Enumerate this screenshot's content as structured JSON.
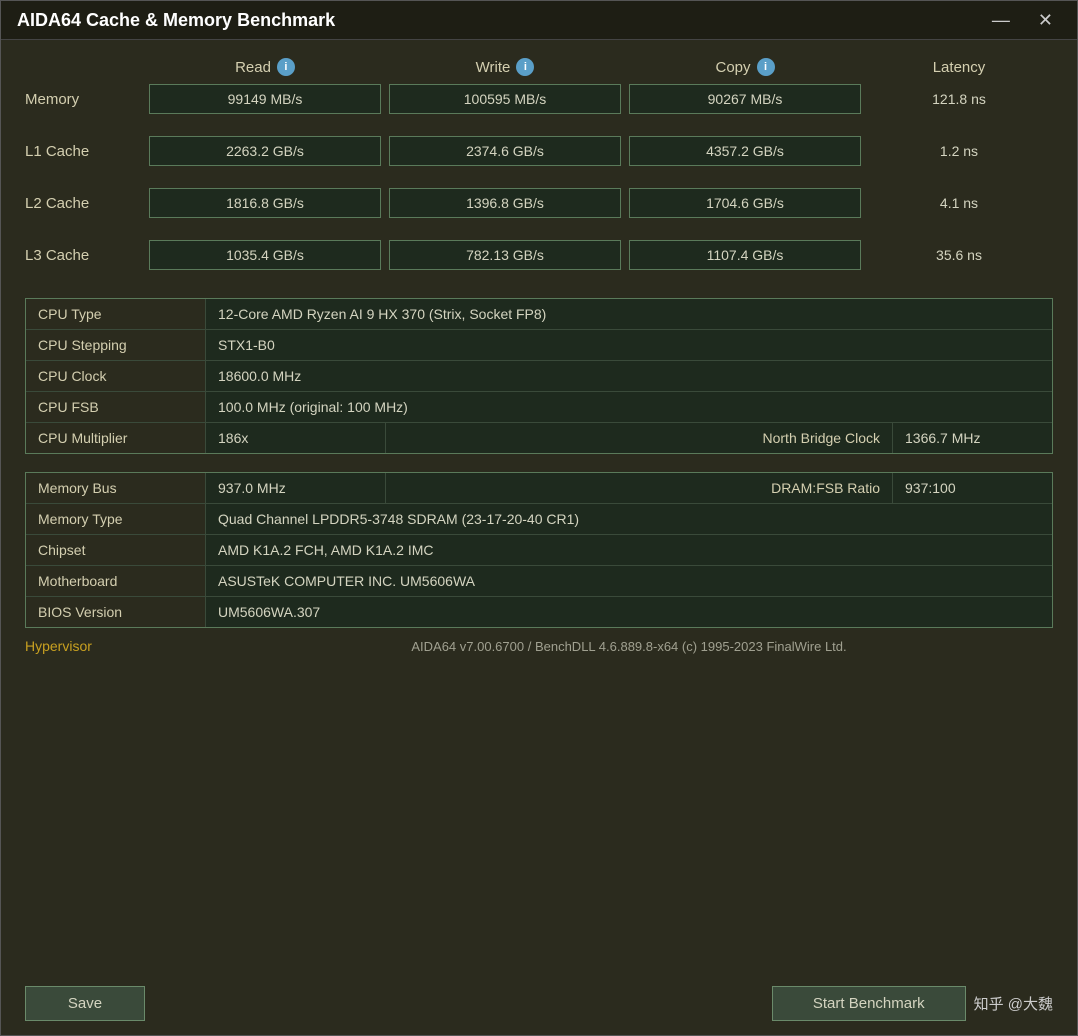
{
  "window": {
    "title": "AIDA64 Cache & Memory Benchmark",
    "minimize_label": "—",
    "close_label": "✕"
  },
  "headers": {
    "read": "Read",
    "write": "Write",
    "copy": "Copy",
    "latency": "Latency"
  },
  "rows": [
    {
      "label": "Memory",
      "read": "99149 MB/s",
      "write": "100595 MB/s",
      "copy": "90267 MB/s",
      "latency": "121.8 ns"
    },
    {
      "label": "L1 Cache",
      "read": "2263.2 GB/s",
      "write": "2374.6 GB/s",
      "copy": "4357.2 GB/s",
      "latency": "1.2 ns"
    },
    {
      "label": "L2 Cache",
      "read": "1816.8 GB/s",
      "write": "1396.8 GB/s",
      "copy": "1704.6 GB/s",
      "latency": "4.1 ns"
    },
    {
      "label": "L3 Cache",
      "read": "1035.4 GB/s",
      "write": "782.13 GB/s",
      "copy": "1107.4 GB/s",
      "latency": "35.6 ns"
    }
  ],
  "cpu_info": {
    "cpu_type_label": "CPU Type",
    "cpu_type_value": "12-Core AMD Ryzen AI 9 HX 370  (Strix, Socket FP8)",
    "cpu_stepping_label": "CPU Stepping",
    "cpu_stepping_value": "STX1-B0",
    "cpu_clock_label": "CPU Clock",
    "cpu_clock_value": "18600.0 MHz",
    "cpu_fsb_label": "CPU FSB",
    "cpu_fsb_value": "100.0 MHz  (original: 100 MHz)",
    "cpu_multiplier_label": "CPU Multiplier",
    "cpu_multiplier_value": "186x",
    "north_bridge_clock_label": "North Bridge Clock",
    "north_bridge_clock_value": "1366.7 MHz"
  },
  "memory_info": {
    "memory_bus_label": "Memory Bus",
    "memory_bus_value": "937.0 MHz",
    "dram_fsb_label": "DRAM:FSB Ratio",
    "dram_fsb_value": "937:100",
    "memory_type_label": "Memory Type",
    "memory_type_value": "Quad Channel LPDDR5-3748 SDRAM  (23-17-20-40 CR1)",
    "chipset_label": "Chipset",
    "chipset_value": "AMD K1A.2 FCH, AMD K1A.2 IMC",
    "motherboard_label": "Motherboard",
    "motherboard_value": "ASUSTeK COMPUTER INC. UM5606WA",
    "bios_label": "BIOS Version",
    "bios_value": "UM5606WA.307"
  },
  "footer": {
    "hypervisor_label": "Hypervisor",
    "hypervisor_value": "AIDA64 v7.00.6700 / BenchDLL 4.6.889.8-x64  (c) 1995-2023 FinalWire Ltd.",
    "save_label": "Save",
    "benchmark_label": "Start Benchmark",
    "watermark": "知乎 @大魏"
  }
}
